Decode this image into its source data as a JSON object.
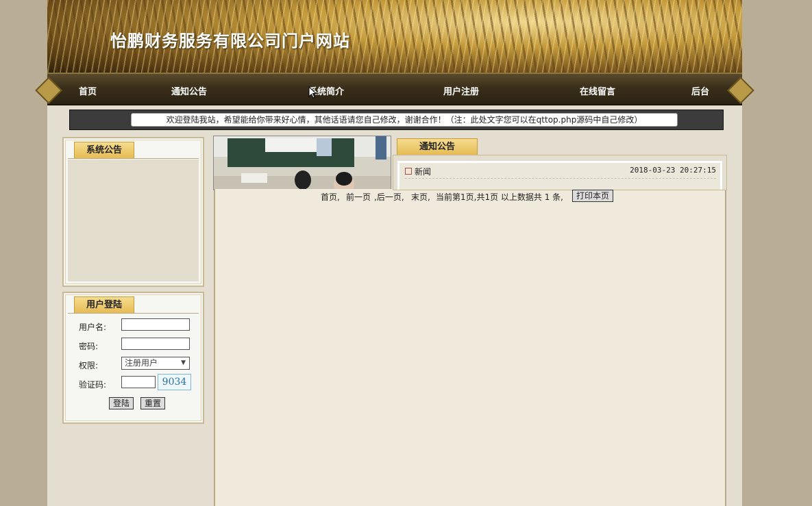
{
  "site": {
    "title": "怡鹏财务服务有限公司门户网站"
  },
  "nav": {
    "items": [
      "首页",
      "通知公告",
      "系统简介",
      "用户注册",
      "在线留言",
      "后台"
    ]
  },
  "marquee": {
    "text": "欢迎登陆我站，希望能给你带来好心情，其他话语请您自己修改，谢谢合作！（注：此处文字您可以在qttop.php源码中自己修改）"
  },
  "sidebar": {
    "notice_title": "系统公告",
    "login_title": "用户登陆",
    "username_label": "用户名:",
    "password_label": "密码:",
    "role_label": "权限:",
    "role_value": "注册用户",
    "captcha_label": "验证码:",
    "captcha_code": "9034",
    "login_button": "登陆",
    "reset_button": "重置"
  },
  "main": {
    "notice_tab": "通知公告",
    "notices": [
      {
        "title": "新闻",
        "date": "2018-03-23 20:27:15"
      }
    ],
    "pager": {
      "first": "首页,",
      "prev": "前一页",
      "next": ",后一页,",
      "last": "末页,",
      "status": "当前第1页,共1页 以上数据共 1 条,",
      "print_button": "打印本页"
    }
  },
  "colors": {
    "tab_gold": "#e6bc55",
    "nav_dark": "#3a2f1a",
    "page_bg": "#e4ded0"
  }
}
